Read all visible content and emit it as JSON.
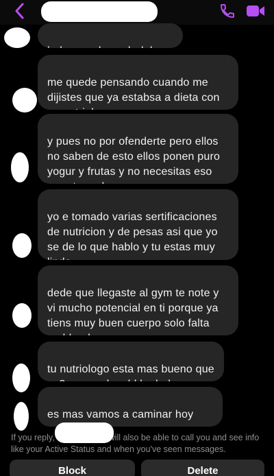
{
  "header": {
    "back_icon": "chevron-left-icon",
    "call_icon": "phone-icon",
    "video_icon": "video-camera-icon",
    "accent_color": "#b84ef5"
  },
  "messages": [
    {
      "text": "hola soy el coach del gym"
    },
    {
      "text": "me quede pensando cuando me\ndijistes que ya estabsa a dieta con\nun nutriologo"
    },
    {
      "text": "y pues no por ofenderte pero ellos\nno saben de esto ellos ponen puro\nyogur y frutas y no necesitas eso\npara tener buen cuerpo"
    },
    {
      "text": "yo e tomado varias sertificaciones\nde nutricion y de pesas asi que yo\nse de lo que hablo y tu estas muy\nlinda"
    },
    {
      "text": "dede que llegaste al gym te note y\nvi mucho potencial en ti porque ya\ntiens muy buen cuerpo solo falta\nmoldearlo"
    },
    {
      "text": "tu nutriologo esta mas bueno que\nyo? porque la vdd lo dudo"
    },
    {
      "text": "es mas vamos a caminar hoy que\nsalgas del gym y platicamso va?"
    }
  ],
  "footer": {
    "notice_part1": "If you reply,",
    "notice_part2": "will also be able to call you and see info like your Active Status and when you've seen messages.",
    "block_label": "Block",
    "delete_label": "Delete"
  }
}
